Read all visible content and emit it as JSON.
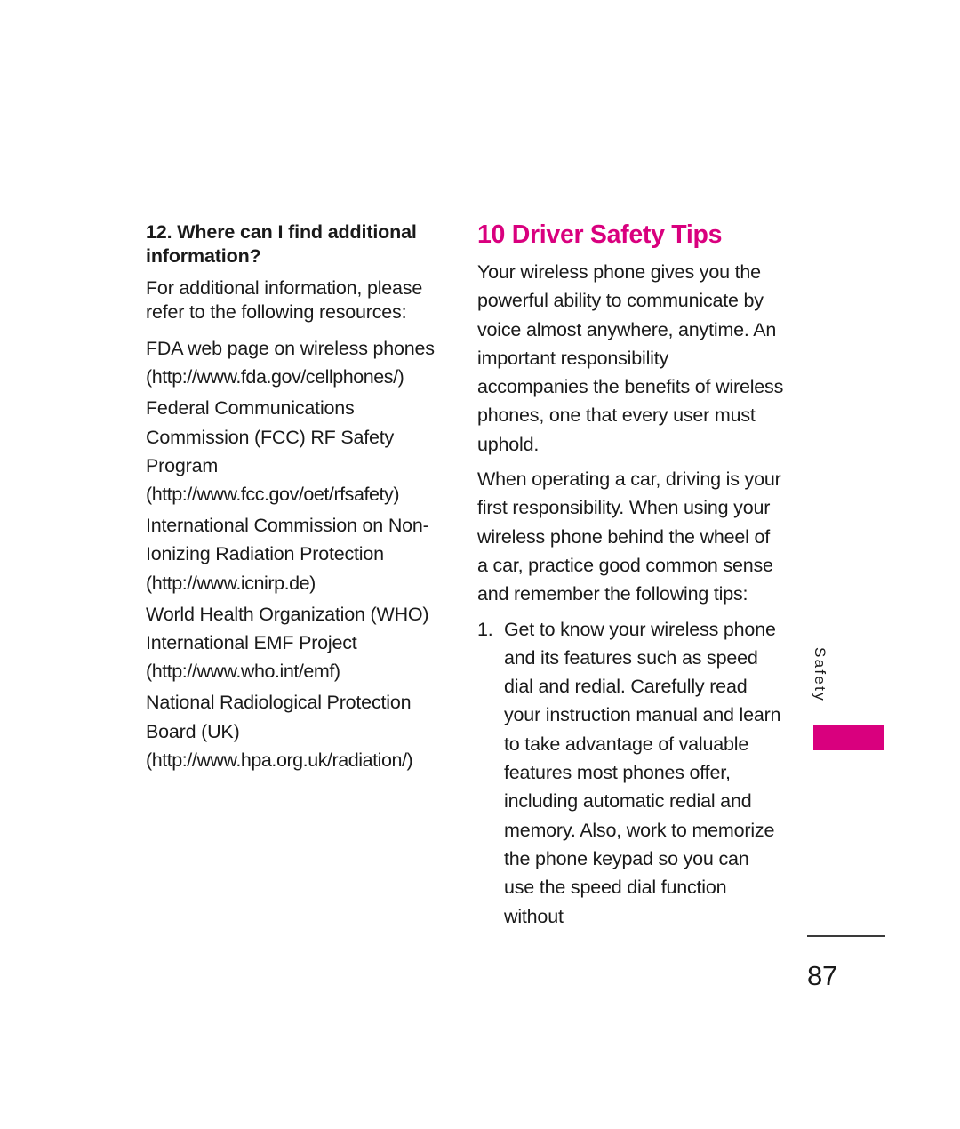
{
  "page": {
    "number": "87",
    "side_tab_label": "Safety",
    "accent_color": "#D9007E",
    "text_color": "#1a1a1a",
    "background_color": "#ffffff"
  },
  "left_column": {
    "heading": "12. Where can I find additional information?",
    "intro_paragraph": "For additional information, please refer to the following resources:",
    "resources": [
      {
        "name": "FDA web page on wireless phones",
        "url": "(http://www.fda.gov/cellphones/)"
      },
      {
        "name": "Federal Communications Commission (FCC) RF Safety Program",
        "url": "(http://www.fcc.gov/oet/rfsafety)"
      },
      {
        "name": "International Commission on Non-Ionizing Radiation Protection",
        "url": "(http://www.icnirp.de)"
      },
      {
        "name": "World Health Organization (WHO) International EMF Project",
        "url": "(http://www.who.int/emf)"
      },
      {
        "name": "National Radiological Protection Board (UK)",
        "url": "(http://www.hpa.org.uk/radiation/)"
      }
    ]
  },
  "right_column": {
    "heading": "10 Driver Safety Tips",
    "paragraphs": [
      "Your wireless phone gives you the powerful ability to communicate by voice almost anywhere, anytime. An important responsibility accompanies the benefits of wireless phones, one that every user must uphold.",
      "When operating a car, driving is your first responsibility. When using your wireless phone behind the wheel of a car, practice good common sense and remember the following tips:"
    ],
    "numbered_items": [
      {
        "marker": "1.",
        "text": "Get to know your wireless phone and its features such as speed dial and redial. Carefully read your instruction manual and learn to take advantage of valuable features most phones offer, including automatic redial and memory. Also, work to memorize the phone keypad so you can use the speed dial function without"
      }
    ]
  }
}
